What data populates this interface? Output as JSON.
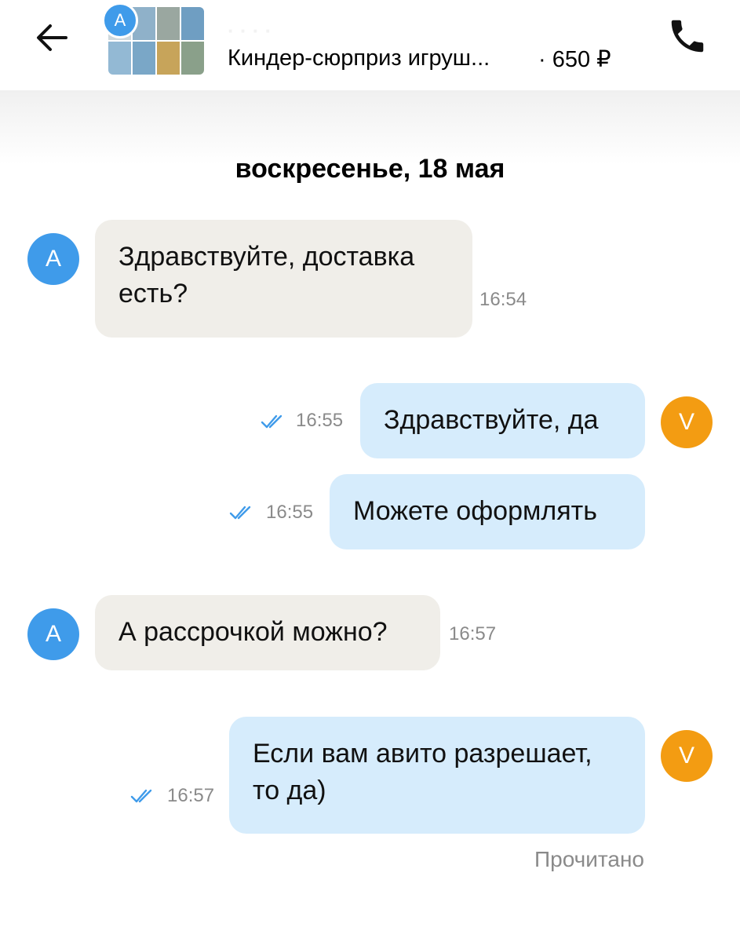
{
  "header": {
    "listing_title": "Киндер-сюрприз игруш...",
    "listing_price": "· 650 ₽",
    "seller_avatar_letter": "A",
    "icons": {
      "back": "arrow-left-icon",
      "call": "phone-icon"
    }
  },
  "chat": {
    "date": "воскресенье, 18 мая",
    "messages": [
      {
        "author": "A",
        "text": "Здравствуйте, доставка есть?",
        "time": "16:54",
        "direction": "in"
      },
      {
        "author": "V",
        "text": "Здравствуйте, да",
        "time": "16:55",
        "direction": "out"
      },
      {
        "author": "V",
        "text": "Можете оформлять",
        "time": "16:55",
        "direction": "out"
      },
      {
        "author": "A",
        "text": "А рассрочкой можно?",
        "time": "16:57",
        "direction": "in"
      },
      {
        "author": "V",
        "text": "Если вам авито разрешает, то да)",
        "time": "16:57",
        "direction": "out"
      }
    ],
    "read_status": "Прочитано"
  },
  "colors": {
    "accent_blue": "#3f9bea",
    "avatar_orange": "#f39c12",
    "incoming_bubble": "#f0eee9",
    "outgoing_bubble": "#d6ecfc",
    "check_color": "#3f9bea"
  }
}
